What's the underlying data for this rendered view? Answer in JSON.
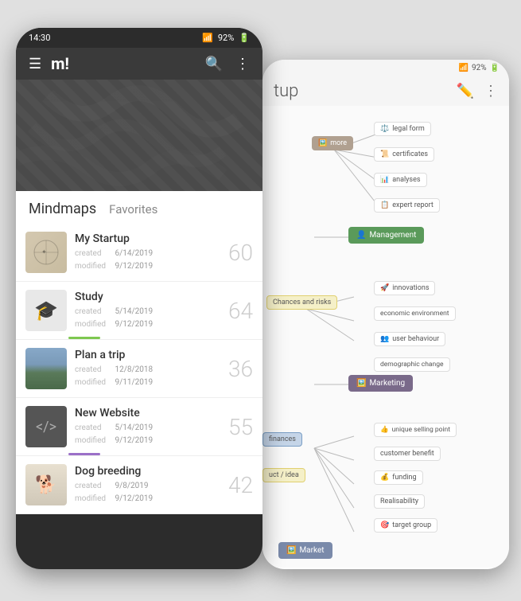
{
  "left_phone": {
    "status_bar": {
      "time": "14:30",
      "wifi": "wifi",
      "signal": "signal",
      "battery": "92%"
    },
    "header": {
      "menu_icon": "hamburger",
      "logo": "m!",
      "search_icon": "search",
      "more_icon": "more-vertical"
    },
    "section": {
      "tab_mindmaps": "Mindmaps",
      "tab_favorites": "Favorites"
    },
    "items": [
      {
        "title": "My Startup",
        "created_label": "created",
        "created_date": "6/14/2019",
        "modified_label": "modified",
        "modified_date": "9/12/2019",
        "count": "60",
        "thumb_type": "startup",
        "bar_color": null
      },
      {
        "title": "Study",
        "created_label": "created",
        "created_date": "5/14/2019",
        "modified_label": "modified",
        "modified_date": "9/12/2019",
        "count": "64",
        "thumb_type": "study",
        "bar_color": "#7ec850"
      },
      {
        "title": "Plan a trip",
        "created_label": "created",
        "created_date": "12/8/2018",
        "modified_label": "modified",
        "modified_date": "9/11/2019",
        "count": "36",
        "thumb_type": "trip",
        "bar_color": null
      },
      {
        "title": "New Website",
        "created_label": "created",
        "created_date": "5/14/2019",
        "modified_label": "modified",
        "modified_date": "9/12/2019",
        "count": "55",
        "thumb_type": "website",
        "bar_color": "#9b70c8"
      },
      {
        "title": "Dog breeding",
        "created_label": "created",
        "created_date": "9/8/2019",
        "modified_label": "modified",
        "modified_date": "9/12/2019",
        "count": "42",
        "thumb_type": "dog",
        "bar_color": null
      }
    ]
  },
  "right_phone": {
    "status_bar": {
      "wifi": "wifi",
      "signal": "signal",
      "battery": "92%"
    },
    "header": {
      "title": "tup",
      "edit_icon": "pencil",
      "more_icon": "more-vertical"
    },
    "nodes": [
      {
        "id": "legal_form",
        "label": "legal form",
        "type": "box"
      },
      {
        "id": "certificates",
        "label": "certificates",
        "type": "box"
      },
      {
        "id": "analyses",
        "label": "analyses",
        "type": "box"
      },
      {
        "id": "expert_report",
        "label": "expert report",
        "type": "box"
      },
      {
        "id": "management",
        "label": "Management",
        "type": "central_green"
      },
      {
        "id": "innovations",
        "label": "innovations",
        "type": "box"
      },
      {
        "id": "economic_env",
        "label": "economic environment",
        "type": "box"
      },
      {
        "id": "chances_risks",
        "label": "Chances and risks",
        "type": "yellow"
      },
      {
        "id": "user_behaviour",
        "label": "user behaviour",
        "type": "box"
      },
      {
        "id": "demographic",
        "label": "demographic change",
        "type": "box"
      },
      {
        "id": "marketing",
        "label": "Marketing",
        "type": "central_purple"
      },
      {
        "id": "unique_selling",
        "label": "unique selling point",
        "type": "box"
      },
      {
        "id": "customer_benefit",
        "label": "customer benefit",
        "type": "box"
      },
      {
        "id": "funding",
        "label": "funding",
        "type": "box"
      },
      {
        "id": "realisability",
        "label": "Realisability",
        "type": "box"
      },
      {
        "id": "target_group",
        "label": "target group",
        "type": "box"
      },
      {
        "id": "market",
        "label": "Market",
        "type": "central_blue"
      }
    ]
  }
}
